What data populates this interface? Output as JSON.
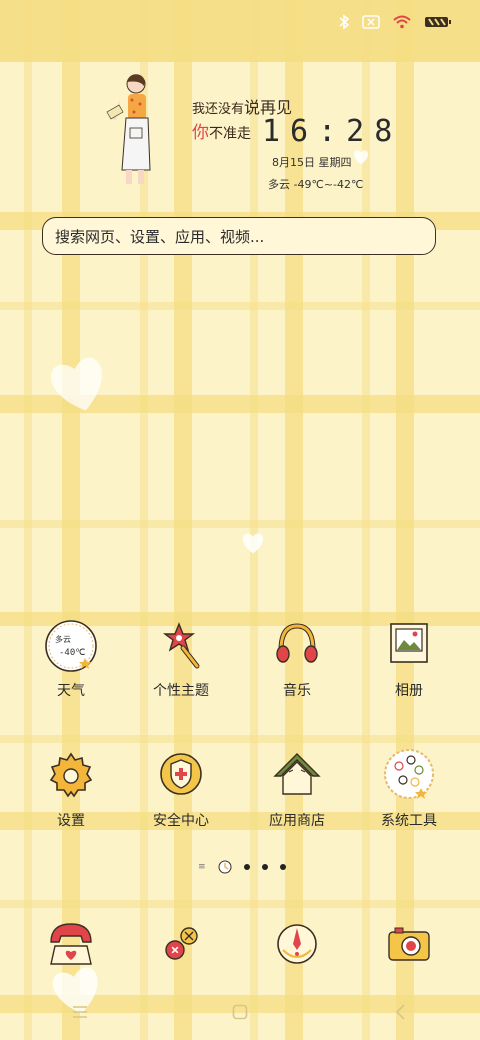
{
  "widget": {
    "line1_prefix": "我还没有",
    "line1_highlight": "说再见",
    "line2_highlight": "你",
    "line2_rest": "不准走",
    "time": "16:28",
    "date": "8月15日 星期四",
    "weather": "多云 -49℃~-42℃"
  },
  "search": {
    "placeholder": "搜索网页、设置、应用、视频..."
  },
  "apps": {
    "row1": [
      {
        "label": "天气",
        "icon": "weather-icon",
        "widget_text": "多云",
        "widget_temp": "-40℃"
      },
      {
        "label": "个性主题",
        "icon": "theme-wand-icon"
      },
      {
        "label": "音乐",
        "icon": "headphones-icon"
      },
      {
        "label": "相册",
        "icon": "photo-album-icon"
      }
    ],
    "row2": [
      {
        "label": "设置",
        "icon": "gear-icon"
      },
      {
        "label": "安全中心",
        "icon": "shield-icon"
      },
      {
        "label": "应用商店",
        "icon": "house-store-icon"
      },
      {
        "label": "系统工具",
        "icon": "tools-folder-icon"
      }
    ]
  },
  "dock": [
    {
      "icon": "phone-icon"
    },
    {
      "icon": "messages-icon"
    },
    {
      "icon": "browser-compass-icon"
    },
    {
      "icon": "camera-icon"
    }
  ],
  "pager": {
    "pages": 3,
    "current": 0
  },
  "colors": {
    "accent_yellow": "#f4dd82",
    "red": "#e0454a",
    "text": "#2b2b2b"
  }
}
